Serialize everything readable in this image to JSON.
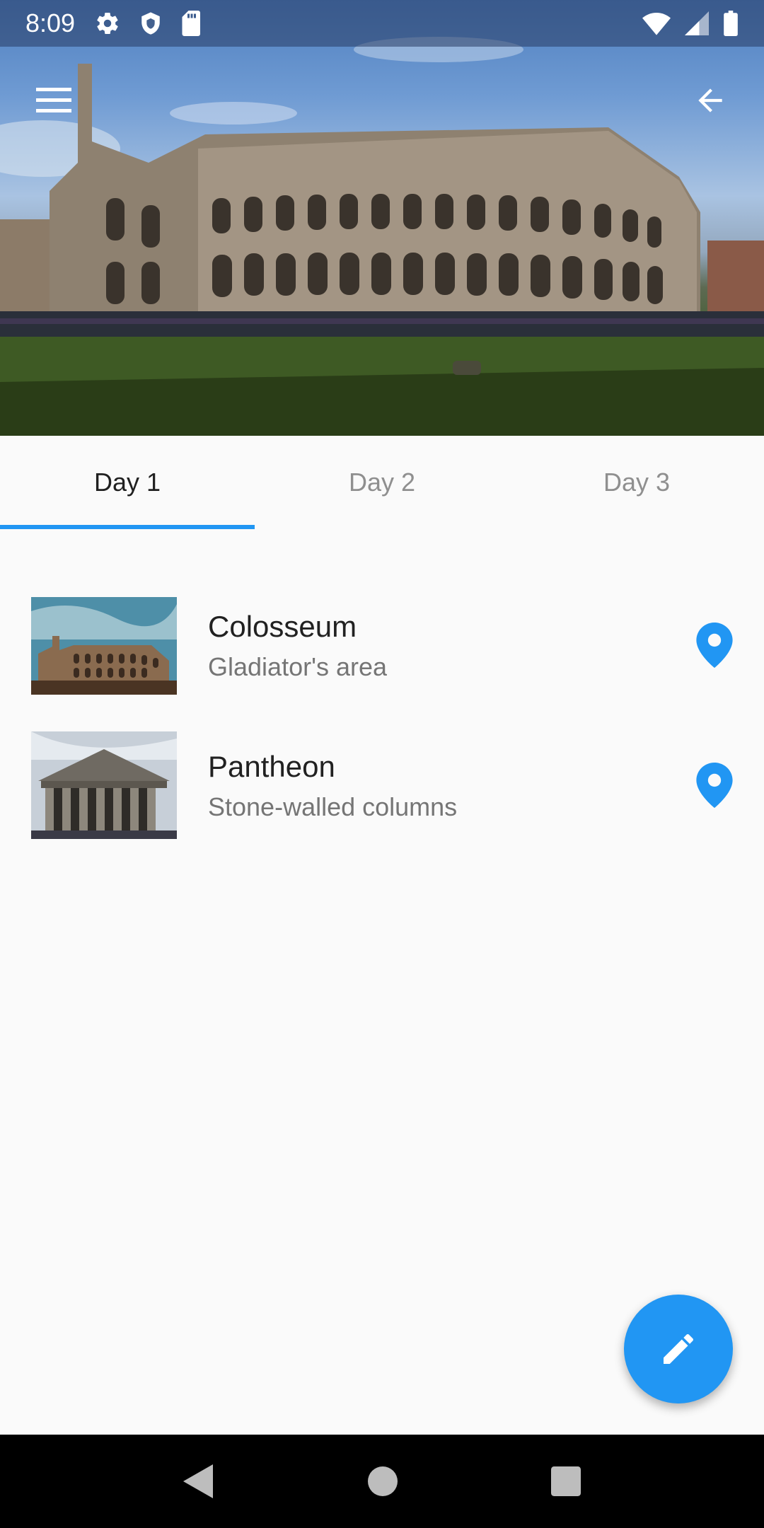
{
  "status_bar": {
    "time": "8:09",
    "left_icons": [
      "gear-icon",
      "shield-icon",
      "sd-card-icon"
    ],
    "right_icons": [
      "wifi-icon",
      "signal-icon",
      "battery-icon"
    ]
  },
  "header": {
    "hero_image": "colosseum-photo",
    "menu_icon": "menu-icon",
    "back_icon": "arrow-back-icon"
  },
  "tabs": [
    {
      "label": "Day 1",
      "active": true
    },
    {
      "label": "Day 2",
      "active": false
    },
    {
      "label": "Day 3",
      "active": false
    }
  ],
  "places": [
    {
      "title": "Colosseum",
      "subtitle": "Gladiator's area",
      "thumbnail": "colosseum-thumbnail",
      "icon": "location-pin-icon"
    },
    {
      "title": "Pantheon",
      "subtitle": "Stone-walled columns",
      "thumbnail": "pantheon-thumbnail",
      "icon": "location-pin-icon"
    }
  ],
  "fab": {
    "icon": "edit-pencil-icon"
  },
  "colors": {
    "accent": "#2196f3",
    "active_tab_text": "#202020",
    "inactive_tab_text": "#8f8f8f",
    "subtitle": "#757575"
  },
  "nav_bar": {
    "icons": [
      "back-triangle-icon",
      "home-circle-icon",
      "recents-square-icon"
    ]
  }
}
